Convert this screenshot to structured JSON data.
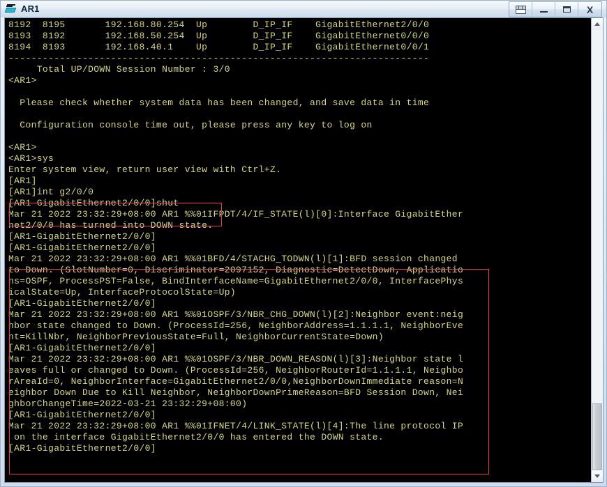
{
  "window": {
    "title": "AR1",
    "icon": "router-icon",
    "buttons": [
      {
        "name": "tile-windows-button",
        "glyph": "tile"
      },
      {
        "name": "minimize-button",
        "glyph": "minimize"
      },
      {
        "name": "maximize-button",
        "glyph": "maximize"
      },
      {
        "name": "close-button",
        "glyph": "close"
      }
    ],
    "close_label": "X"
  },
  "terminal": {
    "foreground_color": "#d7d77a",
    "background_color": "#000000",
    "annotation_color": "#e03c4a",
    "lines": [
      "8192  8195       192.168.80.254  Up        D_IP_IF    GigabitEthernet2/0/0",
      "8193  8192       192.168.50.254  Up        D_IP_IF    GigabitEthernet0/0/0",
      "8194  8193       192.168.40.1    Up        D_IP_IF    GigabitEthernet0/0/1",
      "--------------------------------------------------------------------------",
      "     Total UP/DOWN Session Number : 3/0",
      "<AR1>",
      "",
      "  Please check whether system data has been changed, and save data in time",
      "",
      "  Configuration console time out, please press any key to log on",
      "",
      "<AR1>",
      "<AR1>sys",
      "Enter system view, return user view with Ctrl+Z.",
      "[AR1]",
      "[AR1]int g2/0/0",
      "[AR1-GigabitEthernet2/0/0]shut",
      "Mar 21 2022 23:32:29+08:00 AR1 %%01IFPDT/4/IF_STATE(l)[0]:Interface GigabitEther",
      "net2/0/0 has turned into DOWN state.",
      "[AR1-GigabitEthernet2/0/0]",
      "[AR1-GigabitEthernet2/0/0]",
      "Mar 21 2022 23:32:29+08:00 AR1 %%01BFD/4/STACHG_TODWN(l)[1]:BFD session changed",
      "to Down. (SlotNumber=0, Discriminator=2097152, Diagnostic=DetectDown, Applicatio",
      "ns=OSPF, ProcessPST=False, BindInterfaceName=GigabitEthernet2/0/0, InterfacePhys",
      "icalState=Up, InterfaceProtocolState=Up)",
      "[AR1-GigabitEthernet2/0/0]",
      "Mar 21 2022 23:32:29+08:00 AR1 %%01OSPF/3/NBR_CHG_DOWN(l)[2]:Neighbor event:neig",
      "hbor state changed to Down. (ProcessId=256, NeighborAddress=1.1.1.1, NeighborEve",
      "nt=KillNbr, NeighborPreviousState=Full, NeighborCurrentState=Down)",
      "[AR1-GigabitEthernet2/0/0]",
      "Mar 21 2022 23:32:29+08:00 AR1 %%01OSPF/3/NBR_DOWN_REASON(l)[3]:Neighbor state l",
      "eaves full or changed to Down. (ProcessId=256, NeighborRouterId=1.1.1.1, Neighbo",
      "rAreaId=0, NeighborInterface=GigabitEthernet2/0/0,NeighborDownImmediate reason=N",
      "eighbor Down Due to Kill Neighbor, NeighborDownPrimeReason=BFD Session Down, Nei",
      "ghborChangeTime=2022-03-21 23:32:29+08:00)",
      "[AR1-GigabitEthernet2/0/0]",
      "Mar 21 2022 23:32:29+08:00 AR1 %%01IFNET/4/LINK_STATE(l)[4]:The line protocol IP",
      " on the interface GigabitEthernet2/0/0 has entered the DOWN state.",
      "[AR1-GigabitEthernet2/0/0]"
    ],
    "annotations": [
      {
        "name": "highlight-box-command",
        "label": "shutdown command highlight"
      },
      {
        "name": "highlight-box-log-messages",
        "label": "BFD / OSPF down log highlight"
      }
    ]
  },
  "scrollbar": {
    "up_arrow": "scroll-up-arrow",
    "down_arrow": "scroll-down-arrow",
    "position": "bottom"
  }
}
